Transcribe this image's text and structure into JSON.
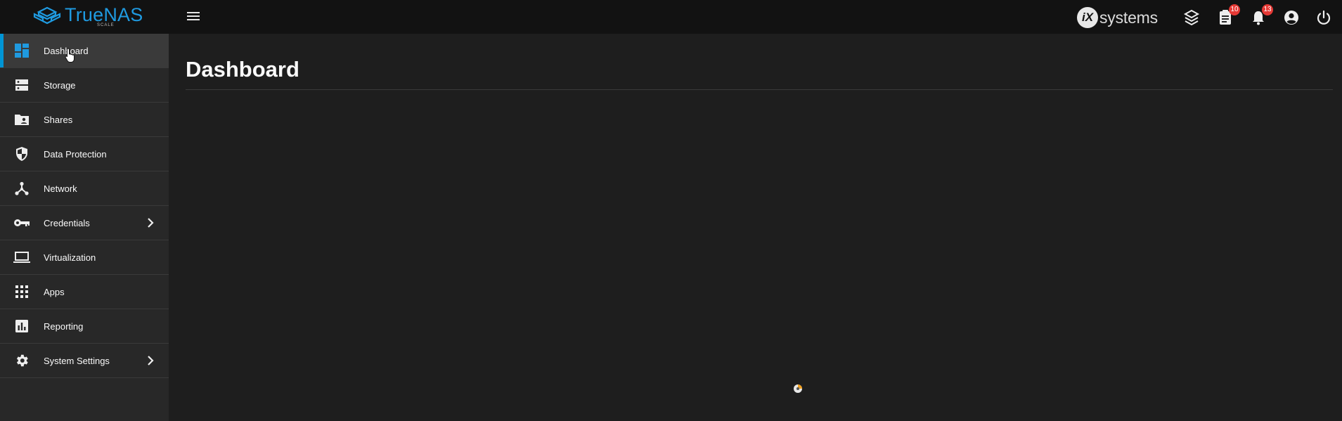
{
  "app": {
    "brand_name": "TrueNAS",
    "brand_sub": "SCALE",
    "vendor_logo_text": "systems",
    "vendor_logo_mark": "iX"
  },
  "header": {
    "menu_icon": "hamburger-menu-icon",
    "icons": [
      {
        "name": "truecommand-icon",
        "badge": null
      },
      {
        "name": "task-manager-icon",
        "badge": "10"
      },
      {
        "name": "alerts-bell-icon",
        "badge": "13"
      },
      {
        "name": "account-icon",
        "badge": null
      },
      {
        "name": "power-icon",
        "badge": null
      }
    ]
  },
  "sidebar": {
    "items": [
      {
        "label": "Dashboard",
        "icon": "dashboard-icon",
        "active": true,
        "expandable": false
      },
      {
        "label": "Storage",
        "icon": "storage-icon",
        "active": false,
        "expandable": false
      },
      {
        "label": "Shares",
        "icon": "shares-folder-icon",
        "active": false,
        "expandable": false
      },
      {
        "label": "Data Protection",
        "icon": "shield-icon",
        "active": false,
        "expandable": false
      },
      {
        "label": "Network",
        "icon": "network-icon",
        "active": false,
        "expandable": false
      },
      {
        "label": "Credentials",
        "icon": "key-icon",
        "active": false,
        "expandable": true
      },
      {
        "label": "Virtualization",
        "icon": "laptop-icon",
        "active": false,
        "expandable": false
      },
      {
        "label": "Apps",
        "icon": "apps-grid-icon",
        "active": false,
        "expandable": false
      },
      {
        "label": "Reporting",
        "icon": "reporting-chart-icon",
        "active": false,
        "expandable": false
      },
      {
        "label": "System Settings",
        "icon": "gear-icon",
        "active": false,
        "expandable": true
      }
    ]
  },
  "main": {
    "title": "Dashboard"
  },
  "colors": {
    "accent": "#0095d5",
    "topbar": "#121212",
    "sidebar": "#282828",
    "content": "#1e1e1e",
    "badge": "#e53935"
  }
}
